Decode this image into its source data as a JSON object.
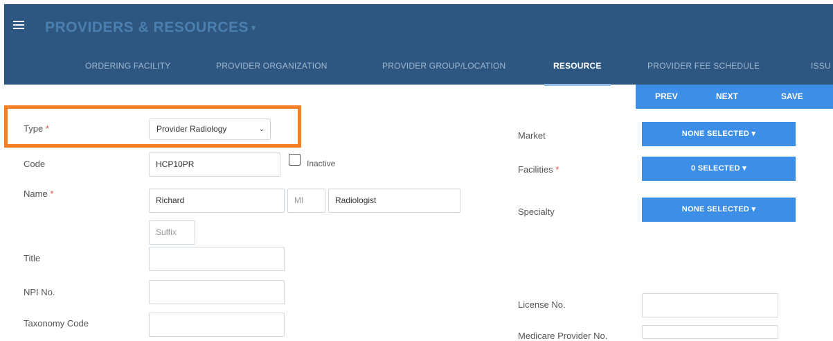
{
  "header": {
    "title": "PROVIDERS & RESOURCES",
    "title_chevron": "▾",
    "menu_icon": "hamburger-menu-icon"
  },
  "tabs": [
    {
      "label": "ORDERING FACILITY",
      "active": false
    },
    {
      "label": "PROVIDER ORGANIZATION",
      "active": false
    },
    {
      "label": "PROVIDER GROUP/LOCATION",
      "active": false
    },
    {
      "label": "RESOURCE",
      "active": true
    },
    {
      "label": "PROVIDER FEE SCHEDULE",
      "active": false
    },
    {
      "label": "ISSU",
      "active": false
    }
  ],
  "actions": {
    "prev": "PREV",
    "next": "NEXT",
    "save": "SAVE"
  },
  "form": {
    "type": {
      "label": "Type",
      "value": "Provider Radiology",
      "chevron": "⌄"
    },
    "code": {
      "label": "Code",
      "value": "HCP10PR"
    },
    "inactive": {
      "label": "Inactive",
      "checked": false
    },
    "name": {
      "label": "Name",
      "first": "Richard",
      "middle_placeholder": "MI",
      "last": "Radiologist",
      "suffix_placeholder": "Suffix"
    },
    "title": {
      "label": "Title",
      "value": ""
    },
    "npi": {
      "label": "NPI No.",
      "value": ""
    },
    "taxonomy": {
      "label": "Taxonomy Code",
      "value": ""
    },
    "required_marker": "*",
    "market": {
      "label": "Market",
      "value": "NONE SELECTED ▾"
    },
    "facilities": {
      "label": "Facilities",
      "value": "0 SELECTED ▾"
    },
    "specialty": {
      "label": "Specialty",
      "value": "NONE SELECTED ▾"
    },
    "license": {
      "label": "License No.",
      "value": ""
    },
    "medicare": {
      "label": "Medicare Provider No.",
      "value": ""
    }
  },
  "colors": {
    "header_bg": "#2d5781",
    "accent": "#3d8ee6",
    "highlight": "#f57f26"
  }
}
